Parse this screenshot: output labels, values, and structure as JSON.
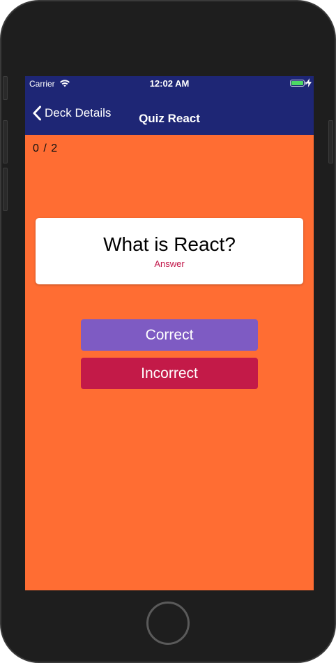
{
  "status_bar": {
    "carrier": "Carrier",
    "time": "12:02 AM",
    "battery_level": 1.0,
    "battery_color": "#4cd964",
    "charging": true
  },
  "nav": {
    "back_label": "Deck Details",
    "title": "Quiz React",
    "background": "#1e2675"
  },
  "quiz": {
    "counter": "0  /  2",
    "question": "What is React?",
    "toggle_label": "Answer",
    "background": "#ff6d33"
  },
  "actions": {
    "correct_label": "Correct",
    "correct_color": "#7e5bc3",
    "incorrect_label": "Incorrect",
    "incorrect_color": "#c31a48"
  },
  "icons": {
    "wifi": "wifi-icon",
    "battery": "battery-icon",
    "charge": "charging-bolt-icon",
    "back": "chevron-left-icon",
    "home": "home-button"
  }
}
